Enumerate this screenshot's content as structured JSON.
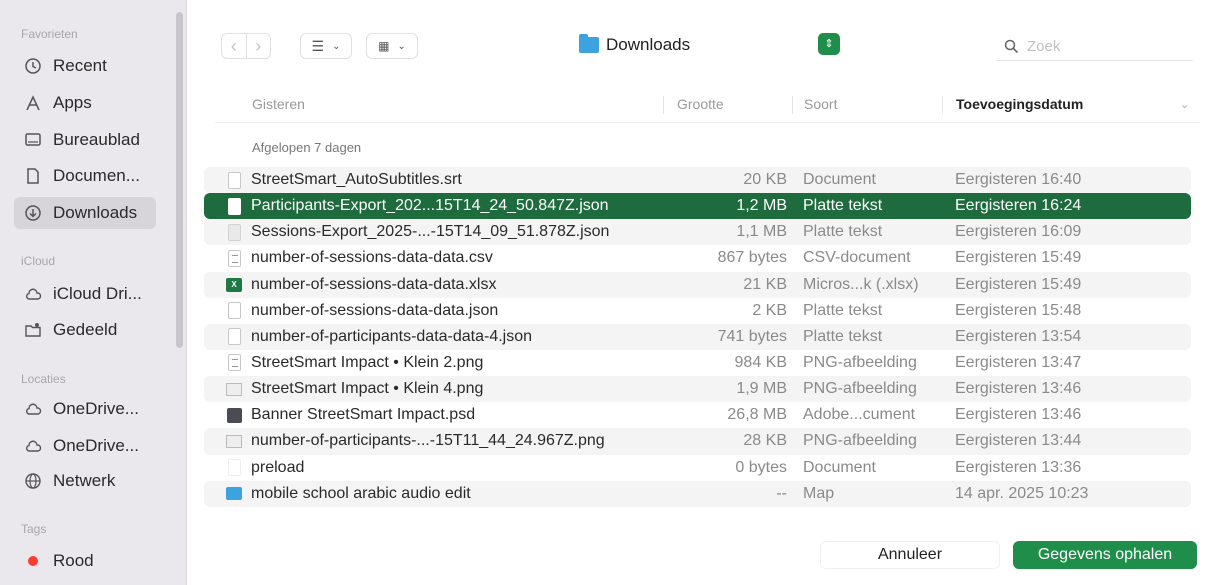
{
  "sidebar": {
    "sections": {
      "favorites": "Favorieten",
      "icloud": "iCloud",
      "locations": "Locaties",
      "tags": "Tags"
    },
    "items": [
      {
        "label": "Recent",
        "icon": "clock-icon"
      },
      {
        "label": "Apps",
        "icon": "apps-icon"
      },
      {
        "label": "Bureaublad",
        "icon": "desktop-icon"
      },
      {
        "label": "Documen...",
        "icon": "document-icon"
      },
      {
        "label": "Downloads",
        "icon": "download-icon",
        "active": true
      },
      {
        "label": "iCloud Dri...",
        "icon": "cloud-icon"
      },
      {
        "label": "Gedeeld",
        "icon": "shared-folder-icon"
      },
      {
        "label": "OneDrive...",
        "icon": "cloud-icon"
      },
      {
        "label": "OneDrive...",
        "icon": "cloud-icon"
      },
      {
        "label": "Netwerk",
        "icon": "network-icon"
      },
      {
        "label": "Rood",
        "icon": "red-tag-icon",
        "color": "#ff3b30"
      }
    ]
  },
  "toolbar": {
    "location": "Downloads",
    "search_placeholder": "Zoek"
  },
  "columns": {
    "name": "Gisteren",
    "size": "Grootte",
    "kind": "Soort",
    "date": "Toevoegingsdatum"
  },
  "group_label": "Afgelopen 7 dagen",
  "files": [
    {
      "name": "StreetSmart_AutoSubtitles.srt",
      "size": "20 KB",
      "kind": "Document",
      "date": "Eergisteren 16:40",
      "icon": "document-icon"
    },
    {
      "name": "Participants-Export_202...15T14_24_50.847Z.json",
      "size": "1,2 MB",
      "kind": "Platte tekst",
      "date": "Eergisteren 16:24",
      "icon": "document-icon",
      "selected": true
    },
    {
      "name": "Sessions-Export_2025-...-15T14_09_51.878Z.json",
      "size": "1,1 MB",
      "kind": "Platte tekst",
      "date": "Eergisteren 16:09",
      "icon": "document-icon"
    },
    {
      "name": "number-of-sessions-data-data.csv",
      "size": "867 bytes",
      "kind": "CSV-document",
      "date": "Eergisteren 15:49",
      "icon": "csv-icon"
    },
    {
      "name": "number-of-sessions-data-data.xlsx",
      "size": "21 KB",
      "kind": "Micros...k (.xlsx)",
      "date": "Eergisteren 15:49",
      "icon": "excel-icon"
    },
    {
      "name": "number-of-sessions-data-data.json",
      "size": "2 KB",
      "kind": "Platte tekst",
      "date": "Eergisteren 15:48",
      "icon": "document-icon"
    },
    {
      "name": "number-of-participants-data-data-4.json",
      "size": "741 bytes",
      "kind": "Platte tekst",
      "date": "Eergisteren 13:54",
      "icon": "document-icon"
    },
    {
      "name": "StreetSmart Impact • Klein 2.png",
      "size": "984 KB",
      "kind": "PNG-afbeelding",
      "date": "Eergisteren 13:47",
      "icon": "image-icon"
    },
    {
      "name": "StreetSmart Impact • Klein 4.png",
      "size": "1,9 MB",
      "kind": "PNG-afbeelding",
      "date": "Eergisteren 13:46",
      "icon": "image-icon"
    },
    {
      "name": "Banner StreetSmart Impact.psd",
      "size": "26,8 MB",
      "kind": "Adobe...cument",
      "date": "Eergisteren 13:46",
      "icon": "psd-icon"
    },
    {
      "name": "number-of-participants-...-15T11_44_24.967Z.png",
      "size": "28 KB",
      "kind": "PNG-afbeelding",
      "date": "Eergisteren 13:44",
      "icon": "image-icon"
    },
    {
      "name": "preload",
      "size": "0 bytes",
      "kind": "Document",
      "date": "Eergisteren 13:36",
      "icon": "blank-document-icon"
    },
    {
      "name": "mobile school arabic audio edit",
      "size": "--",
      "kind": "Map",
      "date": "14 apr. 2025 10:23",
      "icon": "folder-icon"
    }
  ],
  "buttons": {
    "cancel": "Annuleer",
    "confirm": "Gegevens ophalen"
  },
  "colors": {
    "accent": "#1f8e4a",
    "selection": "#1e6b3d",
    "folder": "#3da3e0"
  }
}
